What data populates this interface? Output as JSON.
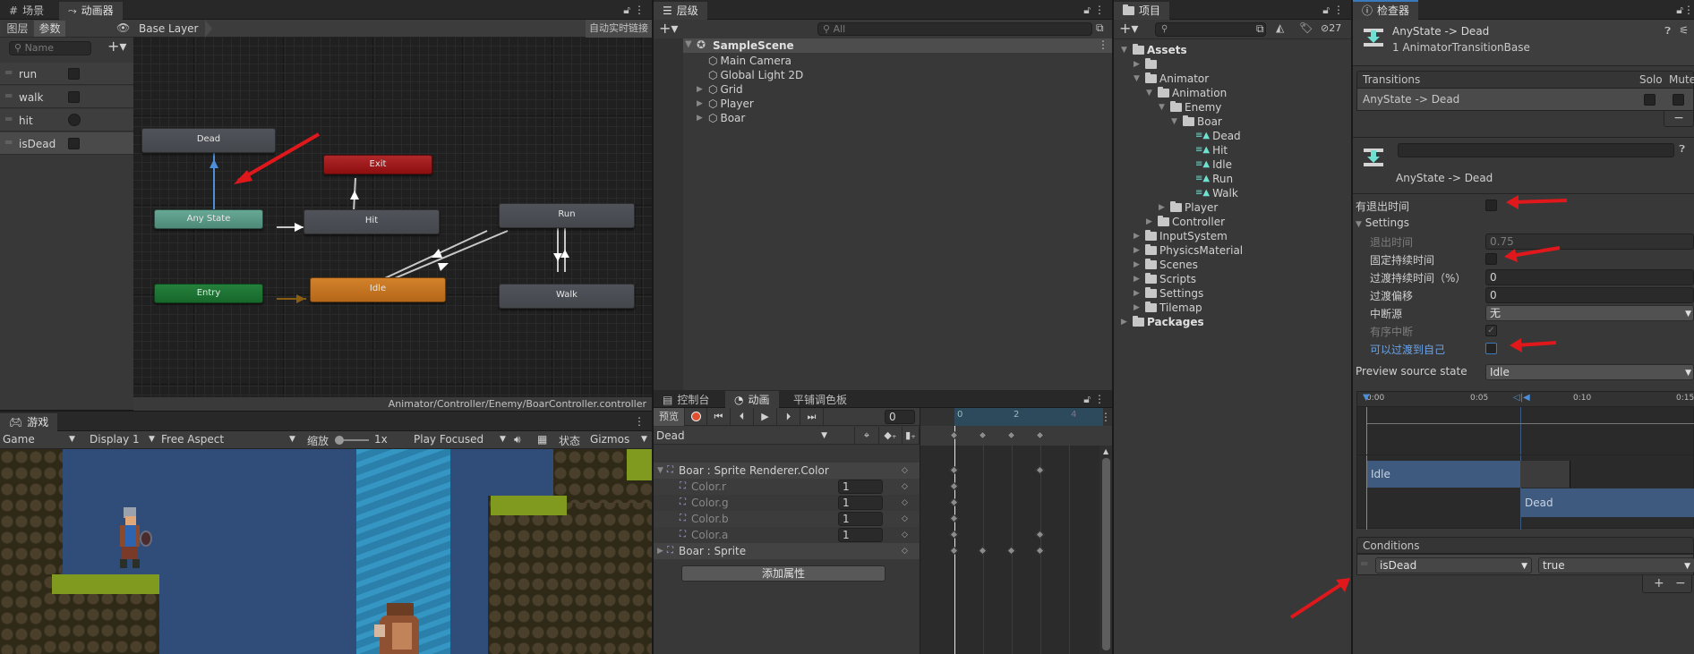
{
  "scene_window": {
    "tabs": [
      {
        "label": "场景",
        "icon": "grid-icon"
      },
      {
        "label": "动画器",
        "icon": "animator-icon"
      }
    ]
  },
  "animator": {
    "subtabs": [
      "图层",
      "参数"
    ],
    "layer": "Base Layer",
    "auto_live_link": "自动实时链接",
    "search_placeholder": "Name",
    "parameters": [
      {
        "name": "run",
        "type": "bool"
      },
      {
        "name": "walk",
        "type": "bool"
      },
      {
        "name": "hit",
        "type": "trigger"
      },
      {
        "name": "isDead",
        "type": "bool",
        "selected": true
      }
    ],
    "nodes": {
      "dead": "Dead",
      "exit": "Exit",
      "any": "Any State",
      "hit": "Hit",
      "run": "Run",
      "entry": "Entry",
      "idle": "Idle",
      "walk": "Walk"
    },
    "path": "Animator/Controller/Enemy/BoarController.controller"
  },
  "hierarchy": {
    "tab": "层级",
    "search_placeholder": "All",
    "scene": "SampleScene",
    "items": [
      {
        "label": "Main Camera",
        "expandable": false
      },
      {
        "label": "Global Light 2D",
        "expandable": false
      },
      {
        "label": "Grid",
        "expandable": true
      },
      {
        "label": "Player",
        "expandable": true
      },
      {
        "label": "Boar",
        "expandable": true
      }
    ]
  },
  "project": {
    "tab": "项目",
    "hidden_count": "27",
    "tree": [
      {
        "label": "Assets",
        "bold": true,
        "depth": 0,
        "open": true,
        "type": "folder"
      },
      {
        "label": "",
        "depth": 1,
        "open": false,
        "type": "folder"
      },
      {
        "label": "Animator",
        "depth": 1,
        "open": true,
        "type": "folder"
      },
      {
        "label": "Animation",
        "depth": 2,
        "open": true,
        "type": "folder"
      },
      {
        "label": "Enemy",
        "depth": 3,
        "open": true,
        "type": "folder"
      },
      {
        "label": "Boar",
        "depth": 4,
        "open": true,
        "type": "folder"
      },
      {
        "label": "Dead",
        "depth": 5,
        "type": "clip"
      },
      {
        "label": "Hit",
        "depth": 5,
        "type": "clip"
      },
      {
        "label": "Idle",
        "depth": 5,
        "type": "clip"
      },
      {
        "label": "Run",
        "depth": 5,
        "type": "clip"
      },
      {
        "label": "Walk",
        "depth": 5,
        "type": "clip"
      },
      {
        "label": "Player",
        "depth": 3,
        "open": false,
        "type": "folder"
      },
      {
        "label": "Controller",
        "depth": 2,
        "open": false,
        "type": "folder"
      },
      {
        "label": "InputSystem",
        "depth": 1,
        "open": false,
        "type": "folder"
      },
      {
        "label": "PhysicsMaterial",
        "depth": 1,
        "open": false,
        "type": "folder"
      },
      {
        "label": "Scenes",
        "depth": 1,
        "open": false,
        "type": "folder"
      },
      {
        "label": "Scripts",
        "depth": 1,
        "open": false,
        "type": "folder"
      },
      {
        "label": "Settings",
        "depth": 1,
        "open": false,
        "type": "folder"
      },
      {
        "label": "Tilemap",
        "depth": 1,
        "open": false,
        "type": "folder"
      },
      {
        "label": "Packages",
        "bold": true,
        "depth": 0,
        "open": false,
        "type": "folder"
      }
    ]
  },
  "inspector": {
    "tab": "检查器",
    "title": "AnyState -> Dead",
    "subtitle": "1 AnimatorTransitionBase",
    "transitions_header": "Transitions",
    "solo": "Solo",
    "mute": "Mute",
    "transition_row": "AnyState -> Dead",
    "transition_name": "AnyState -> Dead",
    "has_exit_time_label": "有退出时间",
    "has_exit_time": false,
    "settings_label": "Settings",
    "exit_time_label": "退出时间",
    "exit_time": "0.75",
    "fixed_duration_label": "固定持续时间",
    "fixed_duration": false,
    "duration_label": "过渡持续时间（%）",
    "duration": "0",
    "offset_label": "过渡偏移",
    "offset": "0",
    "interruption_label": "中断源",
    "interruption": "无",
    "ordered_label": "有序中断",
    "ordered": true,
    "can_self_label": "可以过渡到自己",
    "can_self": false,
    "preview_label": "Preview source state",
    "preview": "Idle",
    "timeline_ticks": [
      "0:00",
      "0:05",
      "0:10",
      "0:15"
    ],
    "timeline_src": "Idle",
    "timeline_dst": "Dead",
    "conditions_header": "Conditions",
    "condition_param": "isDead",
    "condition_value": "true"
  },
  "game": {
    "tab": "游戏",
    "mode": "Game",
    "display": "Display 1",
    "aspect": "Free Aspect",
    "scale_label": "缩放",
    "scale": "1x",
    "play_mode": "Play Focused",
    "stats": "状态",
    "gizmos": "Gizmos"
  },
  "animation": {
    "tabs": [
      {
        "label": "控制台"
      },
      {
        "label": "动画"
      },
      {
        "label": "平铺调色板"
      }
    ],
    "preview": "预览",
    "frame": "0",
    "clip": "Dead",
    "ruler": [
      "0",
      "2",
      "4"
    ],
    "properties": [
      {
        "label": "Boar : Sprite Renderer.Color",
        "group": true,
        "open": true
      },
      {
        "label": "Color.r",
        "value": "1"
      },
      {
        "label": "Color.g",
        "value": "1"
      },
      {
        "label": "Color.b",
        "value": "1"
      },
      {
        "label": "Color.a",
        "value": "1"
      },
      {
        "label": "Boar : Sprite",
        "group": true,
        "open": false
      }
    ],
    "add_property": "添加属性"
  },
  "colors": {
    "accent": "#3a79bb",
    "any_state": "#5a9b88",
    "entry": "#1e7534",
    "exit": "#a11b1c",
    "idle": "#c77722",
    "annotation": "#e0181c"
  }
}
